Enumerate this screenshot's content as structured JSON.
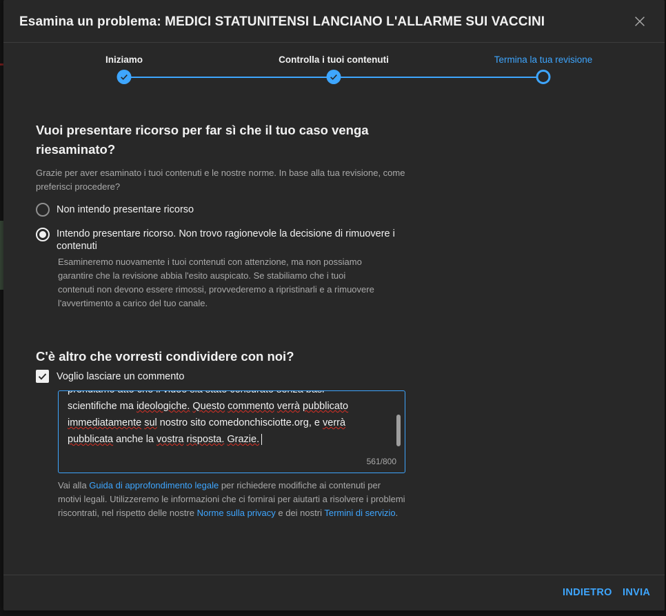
{
  "dialog": {
    "title": "Esamina un problema: MEDICI STATUNITENSI LANCIANO L'ALLARME SUI VACCINI"
  },
  "stepper": {
    "steps": [
      {
        "label": "Iniziamo",
        "state": "done"
      },
      {
        "label": "Controlla i tuoi contenuti",
        "state": "done"
      },
      {
        "label": "Termina la tua revisione",
        "state": "current"
      }
    ]
  },
  "appeal": {
    "heading": "Vuoi presentare ricorso per far sì che il tuo caso venga riesaminato?",
    "description": "Grazie per aver esaminato i tuoi contenuti e le nostre norme. In base alla tua revisione, come preferisci procedere?",
    "options": [
      {
        "label": "Non intendo presentare ricorso",
        "checked": false
      },
      {
        "label": "Intendo presentare ricorso. Non trovo ragionevole la decisione di rimuovere i contenuti",
        "checked": true,
        "sublabel": "Esamineremo nuovamente i tuoi contenuti con attenzione, ma non possiamo garantire che la revisione abbia l'esito auspicato. Se stabiliamo che i tuoi contenuti non devono essere rimossi, provvederemo a ripristinarli e a rimuovere l'avvertimento a carico del tuo canale."
      }
    ]
  },
  "comment": {
    "heading": "C'è altro che vorresti condividere con noi?",
    "checkbox_label": "Voglio lasciare un commento",
    "checkbox_checked": true,
    "text_lines": [
      "prendiamo atto che il video sia stato censurato senza basi",
      "scientifiche ma ideologiche. Questo commento verrà pubblicato",
      "immediatamente sul nostro sito comedonchisciotte.org, e verrà",
      "pubblicata anche la vostra risposta. Grazie."
    ],
    "counter": "561/800"
  },
  "legal": {
    "part1": "Vai alla ",
    "link1": "Guida di approfondimento legale",
    "part2": " per richiedere modifiche ai contenuti per motivi legali. Utilizzeremo le informazioni che ci fornirai per aiutarti a risolvere i problemi riscontrati, nel rispetto delle nostre ",
    "link2": "Norme sulla privacy",
    "part3": " e dei nostri ",
    "link3": "Termini di servizio",
    "part4": "."
  },
  "footer": {
    "back_label": "INDIETRO",
    "submit_label": "INVIA"
  },
  "colors": {
    "accent": "#3ea6ff",
    "dialog_bg": "#282828",
    "spellcheck": "#d93025"
  }
}
